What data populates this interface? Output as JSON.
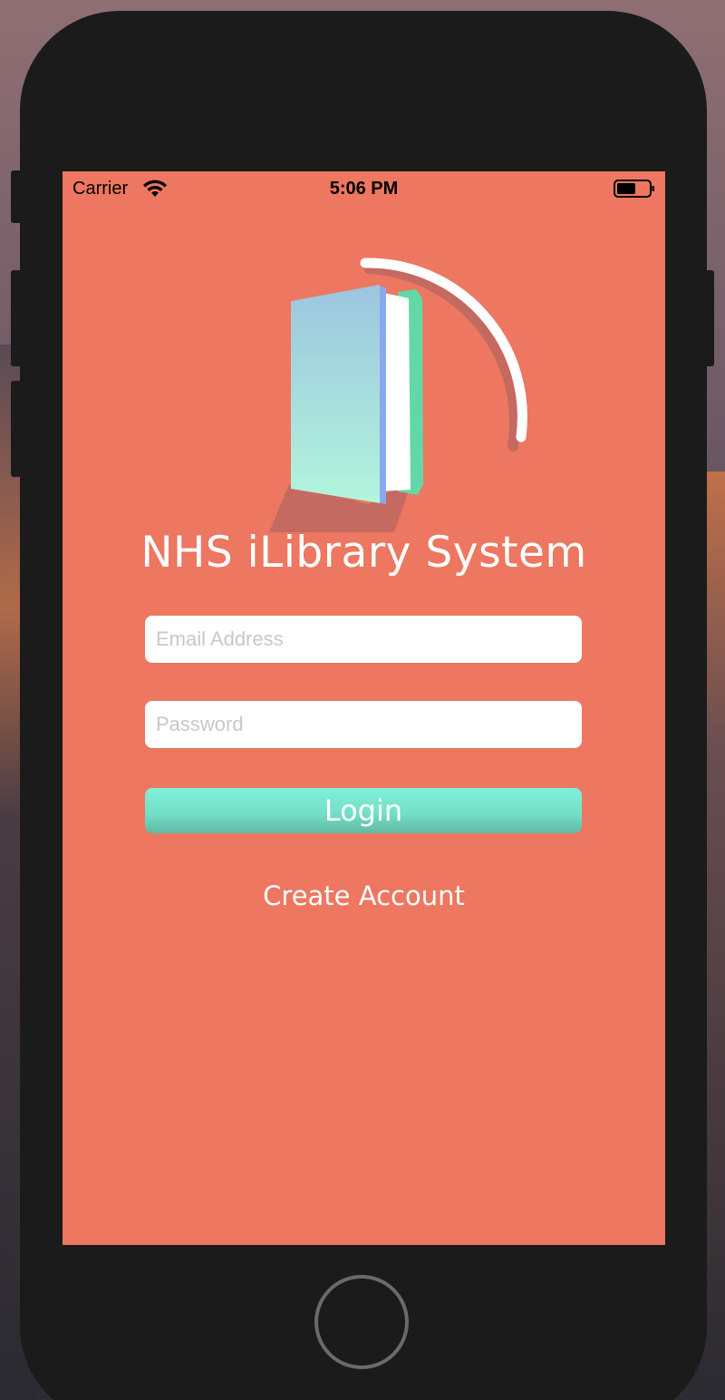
{
  "status_bar": {
    "carrier": "Carrier",
    "time": "5:06 PM",
    "wifi_icon": "wifi-icon",
    "battery_icon": "battery-icon"
  },
  "app": {
    "title": "NHS iLibrary System",
    "logo_icon": "book-logo-icon",
    "background_color": "#ed7760"
  },
  "form": {
    "email_placeholder": "Email Address",
    "email_value": "",
    "password_placeholder": "Password",
    "password_value": "",
    "login_label": "Login",
    "login_color": "#74e0c8",
    "create_account_label": "Create Account"
  },
  "device": {
    "home_button_icon": "home-button-icon"
  }
}
